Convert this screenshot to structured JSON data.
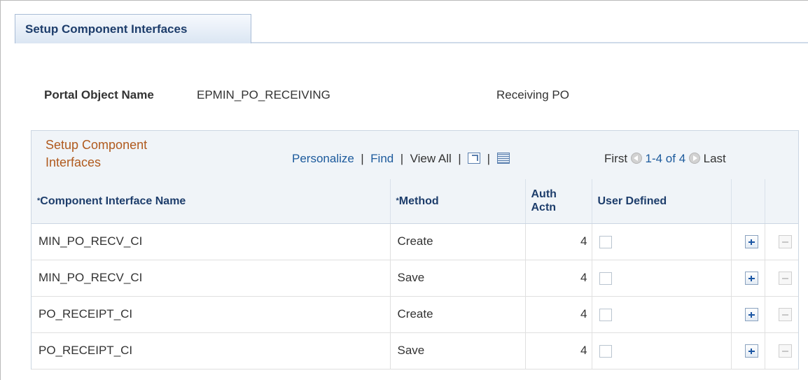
{
  "tab": {
    "label": "Setup Component Interfaces"
  },
  "portal": {
    "label": "Portal Object Name",
    "value": "EPMIN_PO_RECEIVING",
    "description": "Receiving PO"
  },
  "grid": {
    "title": "Setup Component Interfaces",
    "personalize": "Personalize",
    "find": "Find",
    "view_all": "View All",
    "first": "First",
    "range": "1-4 of 4",
    "last": "Last",
    "columns": {
      "ci_name": "Component Interface Name",
      "method": "Method",
      "auth_actn": "Auth Actn",
      "user_defined": "User Defined"
    },
    "rows": [
      {
        "ci_name": "MIN_PO_RECV_CI",
        "method": "Create",
        "auth_actn": "4",
        "user_defined": false
      },
      {
        "ci_name": "MIN_PO_RECV_CI",
        "method": "Save",
        "auth_actn": "4",
        "user_defined": false
      },
      {
        "ci_name": "PO_RECEIPT_CI",
        "method": "Create",
        "auth_actn": "4",
        "user_defined": false
      },
      {
        "ci_name": "PO_RECEIPT_CI",
        "method": "Save",
        "auth_actn": "4",
        "user_defined": false
      }
    ]
  },
  "icons": {
    "zoom": "zoom-grid-icon",
    "download": "download-spreadsheet-icon",
    "previous": "previous-arrow-icon",
    "next": "next-arrow-icon",
    "add_row": "add-row-icon",
    "delete_row": "delete-row-icon"
  },
  "colors": {
    "tab_text": "#1d3d6b",
    "grid_title": "#b05a1e",
    "link": "#1c5a9c",
    "header_bg": "#f0f4f8"
  }
}
